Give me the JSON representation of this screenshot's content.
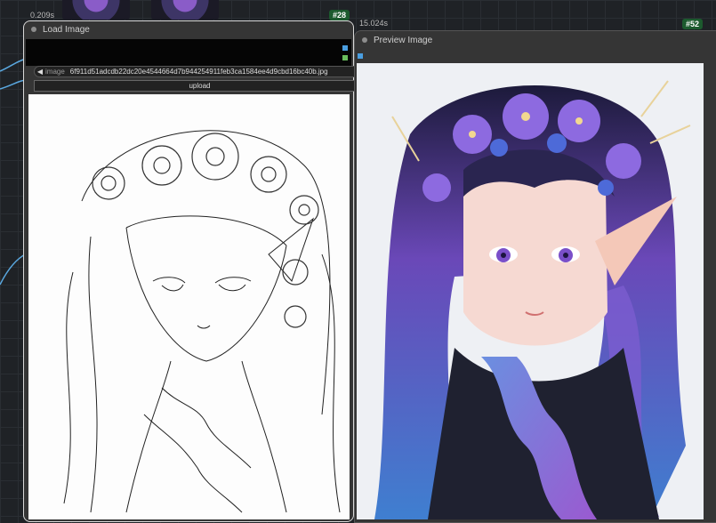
{
  "canvas": {
    "thumb_colors": [
      "#8a5cc8",
      "#3d3566"
    ]
  },
  "load_node": {
    "timing": "0.209s",
    "badge": "#28",
    "title": "Load Image",
    "image_widget_label": "image",
    "image_value": "6f911d51adcdb22dc20e4544664d7b944254911feb3ca1584ee4d9cbd16bc40b.jpg",
    "upload_label": "upload"
  },
  "preview_node": {
    "timing": "15.024s",
    "badge": "#52",
    "title": "Preview Image"
  },
  "colors": {
    "badge_bg": "#1c5a2e",
    "port_blue": "#4a9ee0",
    "port_green": "#6abd5e",
    "link_blue": "#5aa8e0"
  },
  "icons": {
    "left_arrow": "◀",
    "right_arrow": "▶"
  }
}
